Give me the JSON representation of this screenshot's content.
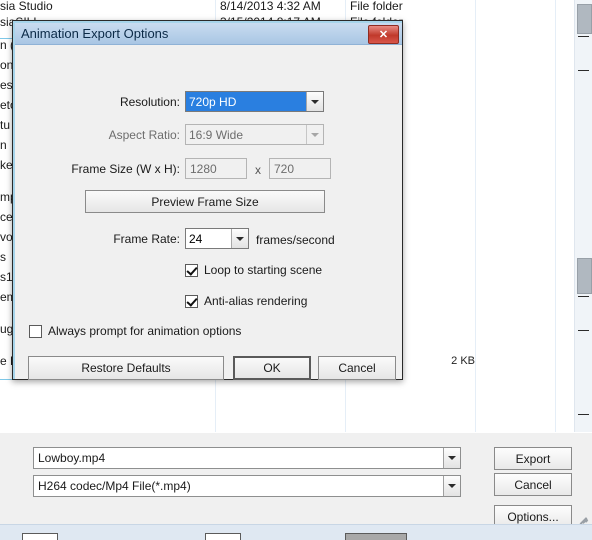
{
  "background": {
    "rows": [
      {
        "name": "sia Studio",
        "date": "8/14/2013 4:32 AM",
        "type": "File folder"
      },
      {
        "name": "siaSILL...",
        "date": "3/15/2014 8:17 AM",
        "type": "File folder"
      }
    ],
    "left_fragments": [
      "n (",
      "on",
      "es",
      "eto",
      "tu",
      "n",
      "ket",
      "mp",
      "cei",
      "vo",
      "s",
      "s1",
      "em",
      "ug",
      "e D"
    ],
    "size_cell": "2 KB"
  },
  "dialog": {
    "title": "Animation Export Options",
    "close_label": "✕",
    "resolution": {
      "label": "Resolution:",
      "value": "720p HD"
    },
    "aspect_ratio": {
      "label": "Aspect Ratio:",
      "value": "16:9 Wide"
    },
    "frame_size": {
      "label": "Frame Size (W x H):",
      "width": "1280",
      "separator": "x",
      "height": "720"
    },
    "preview_button": "Preview Frame Size",
    "frame_rate": {
      "label": "Frame Rate:",
      "value": "24",
      "units": "frames/second"
    },
    "checkboxes": [
      {
        "label": "Loop to starting scene",
        "checked": true
      },
      {
        "label": "Anti-alias rendering",
        "checked": true
      },
      {
        "label": "Always prompt for animation options",
        "checked": false
      }
    ],
    "buttons": {
      "restore_defaults": "Restore Defaults",
      "ok": "OK",
      "cancel": "Cancel"
    }
  },
  "export_panel": {
    "filename": "Lowboy.mp4",
    "format": "H264 codec/Mp4 File(*.mp4)",
    "export_button": "Export",
    "cancel_button": "Cancel",
    "options_button": "Options..."
  },
  "colors": {
    "accent_selection": "#2a7fe0",
    "titlebar": "#a9c6e4",
    "close_button": "#c0392b",
    "dialog_face": "#f0f0f0"
  }
}
